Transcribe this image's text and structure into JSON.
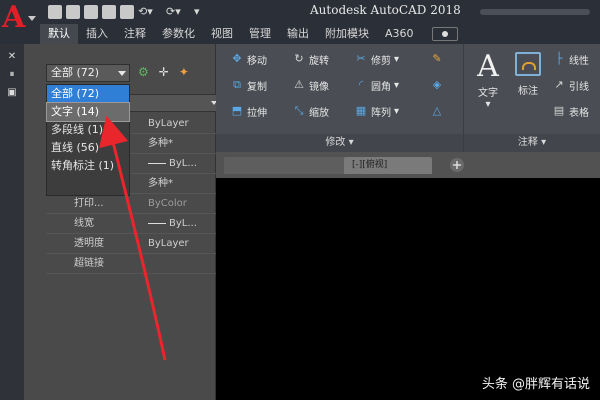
{
  "app": {
    "title": "Autodesk AutoCAD 2018"
  },
  "ribbon_tabs": [
    "默认",
    "插入",
    "注释",
    "参数化",
    "视图",
    "管理",
    "输出",
    "附加模块",
    "A360"
  ],
  "quick_access": {
    "icons": [
      "new-icon",
      "open-icon",
      "save-icon",
      "saveas-icon",
      "print-icon",
      "undo-icon",
      "redo-icon",
      "more-icon"
    ]
  },
  "properties": {
    "filter_value": "全部 (72)",
    "filter_options": [
      "全部 (72)",
      "文字 (14)",
      "多段线 (1)",
      "直线 (56)",
      "转角标注 (1)"
    ],
    "selected_option_index": 0,
    "hover_option_index": 1,
    "rows": [
      {
        "label": "",
        "value": "ByLayer"
      },
      {
        "label": "",
        "value": "多种*"
      },
      {
        "label": "",
        "value": "ByL...",
        "line": true
      },
      {
        "label": "",
        "value": "多种*"
      },
      {
        "label": "打印...",
        "value": "ByColor",
        "dim": true
      },
      {
        "label": "线宽",
        "value": "ByL...",
        "line": true
      },
      {
        "label": "透明度",
        "value": "ByLayer"
      },
      {
        "label": "超链接",
        "value": ""
      }
    ]
  },
  "modify_panel": {
    "title": "修改",
    "buttons": [
      "移动",
      "旋转",
      "修剪",
      "复制",
      "镜像",
      "圆角",
      "拉伸",
      "缩放",
      "阵列"
    ]
  },
  "annotation_panel": {
    "title": "注释",
    "buttons": {
      "text": "文字",
      "dim": "标注",
      "linear": "线性",
      "leader": "引线",
      "table": "表格"
    }
  },
  "file_tab": {
    "active_label": "[-][俯视]"
  },
  "watermark": {
    "text": "头条 @胖辉有话说"
  },
  "colors": {
    "accent": "#2f7fd6",
    "logo_red": "#e01f28",
    "arrow_red": "#e8262c"
  }
}
